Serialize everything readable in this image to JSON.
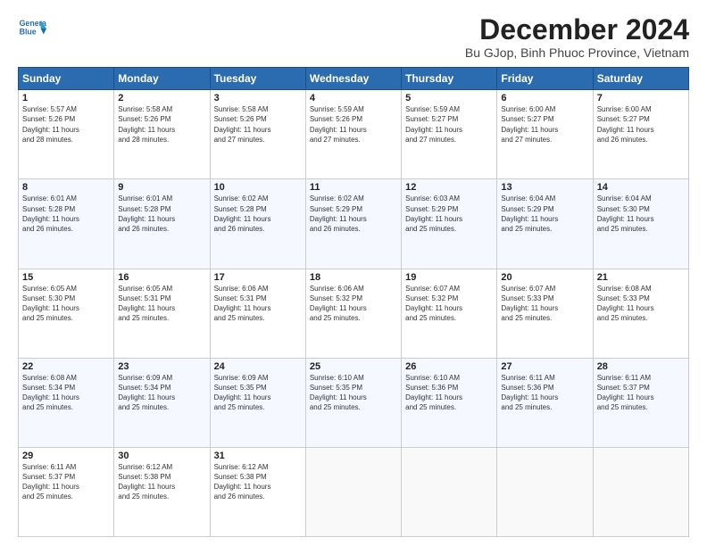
{
  "logo": {
    "line1": "General",
    "line2": "Blue"
  },
  "title": "December 2024",
  "subtitle": "Bu GJop, Binh Phuoc Province, Vietnam",
  "days_of_week": [
    "Sunday",
    "Monday",
    "Tuesday",
    "Wednesday",
    "Thursday",
    "Friday",
    "Saturday"
  ],
  "weeks": [
    [
      {
        "day": "1",
        "info": "Sunrise: 5:57 AM\nSunset: 5:26 PM\nDaylight: 11 hours\nand 28 minutes."
      },
      {
        "day": "2",
        "info": "Sunrise: 5:58 AM\nSunset: 5:26 PM\nDaylight: 11 hours\nand 28 minutes."
      },
      {
        "day": "3",
        "info": "Sunrise: 5:58 AM\nSunset: 5:26 PM\nDaylight: 11 hours\nand 27 minutes."
      },
      {
        "day": "4",
        "info": "Sunrise: 5:59 AM\nSunset: 5:26 PM\nDaylight: 11 hours\nand 27 minutes."
      },
      {
        "day": "5",
        "info": "Sunrise: 5:59 AM\nSunset: 5:27 PM\nDaylight: 11 hours\nand 27 minutes."
      },
      {
        "day": "6",
        "info": "Sunrise: 6:00 AM\nSunset: 5:27 PM\nDaylight: 11 hours\nand 27 minutes."
      },
      {
        "day": "7",
        "info": "Sunrise: 6:00 AM\nSunset: 5:27 PM\nDaylight: 11 hours\nand 26 minutes."
      }
    ],
    [
      {
        "day": "8",
        "info": "Sunrise: 6:01 AM\nSunset: 5:28 PM\nDaylight: 11 hours\nand 26 minutes."
      },
      {
        "day": "9",
        "info": "Sunrise: 6:01 AM\nSunset: 5:28 PM\nDaylight: 11 hours\nand 26 minutes."
      },
      {
        "day": "10",
        "info": "Sunrise: 6:02 AM\nSunset: 5:28 PM\nDaylight: 11 hours\nand 26 minutes."
      },
      {
        "day": "11",
        "info": "Sunrise: 6:02 AM\nSunset: 5:29 PM\nDaylight: 11 hours\nand 26 minutes."
      },
      {
        "day": "12",
        "info": "Sunrise: 6:03 AM\nSunset: 5:29 PM\nDaylight: 11 hours\nand 25 minutes."
      },
      {
        "day": "13",
        "info": "Sunrise: 6:04 AM\nSunset: 5:29 PM\nDaylight: 11 hours\nand 25 minutes."
      },
      {
        "day": "14",
        "info": "Sunrise: 6:04 AM\nSunset: 5:30 PM\nDaylight: 11 hours\nand 25 minutes."
      }
    ],
    [
      {
        "day": "15",
        "info": "Sunrise: 6:05 AM\nSunset: 5:30 PM\nDaylight: 11 hours\nand 25 minutes."
      },
      {
        "day": "16",
        "info": "Sunrise: 6:05 AM\nSunset: 5:31 PM\nDaylight: 11 hours\nand 25 minutes."
      },
      {
        "day": "17",
        "info": "Sunrise: 6:06 AM\nSunset: 5:31 PM\nDaylight: 11 hours\nand 25 minutes."
      },
      {
        "day": "18",
        "info": "Sunrise: 6:06 AM\nSunset: 5:32 PM\nDaylight: 11 hours\nand 25 minutes."
      },
      {
        "day": "19",
        "info": "Sunrise: 6:07 AM\nSunset: 5:32 PM\nDaylight: 11 hours\nand 25 minutes."
      },
      {
        "day": "20",
        "info": "Sunrise: 6:07 AM\nSunset: 5:33 PM\nDaylight: 11 hours\nand 25 minutes."
      },
      {
        "day": "21",
        "info": "Sunrise: 6:08 AM\nSunset: 5:33 PM\nDaylight: 11 hours\nand 25 minutes."
      }
    ],
    [
      {
        "day": "22",
        "info": "Sunrise: 6:08 AM\nSunset: 5:34 PM\nDaylight: 11 hours\nand 25 minutes."
      },
      {
        "day": "23",
        "info": "Sunrise: 6:09 AM\nSunset: 5:34 PM\nDaylight: 11 hours\nand 25 minutes."
      },
      {
        "day": "24",
        "info": "Sunrise: 6:09 AM\nSunset: 5:35 PM\nDaylight: 11 hours\nand 25 minutes."
      },
      {
        "day": "25",
        "info": "Sunrise: 6:10 AM\nSunset: 5:35 PM\nDaylight: 11 hours\nand 25 minutes."
      },
      {
        "day": "26",
        "info": "Sunrise: 6:10 AM\nSunset: 5:36 PM\nDaylight: 11 hours\nand 25 minutes."
      },
      {
        "day": "27",
        "info": "Sunrise: 6:11 AM\nSunset: 5:36 PM\nDaylight: 11 hours\nand 25 minutes."
      },
      {
        "day": "28",
        "info": "Sunrise: 6:11 AM\nSunset: 5:37 PM\nDaylight: 11 hours\nand 25 minutes."
      }
    ],
    [
      {
        "day": "29",
        "info": "Sunrise: 6:11 AM\nSunset: 5:37 PM\nDaylight: 11 hours\nand 25 minutes."
      },
      {
        "day": "30",
        "info": "Sunrise: 6:12 AM\nSunset: 5:38 PM\nDaylight: 11 hours\nand 25 minutes."
      },
      {
        "day": "31",
        "info": "Sunrise: 6:12 AM\nSunset: 5:38 PM\nDaylight: 11 hours\nand 26 minutes."
      },
      {
        "day": "",
        "info": ""
      },
      {
        "day": "",
        "info": ""
      },
      {
        "day": "",
        "info": ""
      },
      {
        "day": "",
        "info": ""
      }
    ]
  ]
}
